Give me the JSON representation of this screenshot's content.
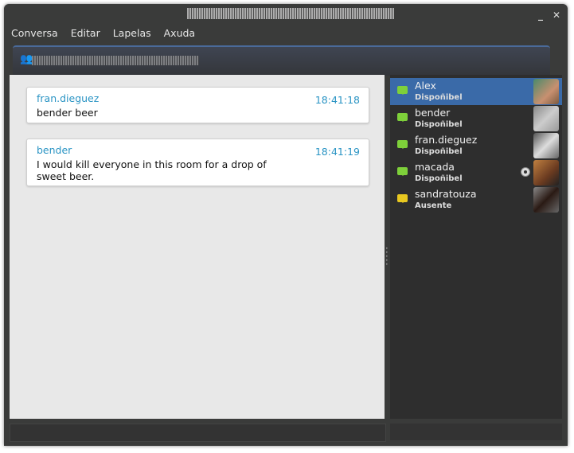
{
  "window": {
    "minimize_icon": "minimize-icon",
    "close_icon": "close-icon"
  },
  "menu": [
    "Conversa",
    "Editar",
    "Lapelas",
    "Axuda"
  ],
  "tab": {
    "icon": "group-chat-icon"
  },
  "messages": [
    {
      "from": "fran.dieguez",
      "time": "18:41:18",
      "body": "bender beer"
    },
    {
      "from": "bender",
      "time": "18:41:19",
      "body": "I would kill everyone in this room for a drop of sweet beer."
    }
  ],
  "contacts": [
    {
      "name": "Alex",
      "status": "Dispoñibel",
      "color": "#7ed03a",
      "selected": true
    },
    {
      "name": "bender",
      "status": "Dispoñibel",
      "color": "#7ed03a"
    },
    {
      "name": "fran.dieguez",
      "status": "Dispoñibel",
      "color": "#7ed03a"
    },
    {
      "name": "macada",
      "status": "Dispoñibel",
      "color": "#7ed03a",
      "webcam": true
    },
    {
      "name": "sandratouza",
      "status": "Ausente",
      "color": "#e8c820"
    }
  ]
}
